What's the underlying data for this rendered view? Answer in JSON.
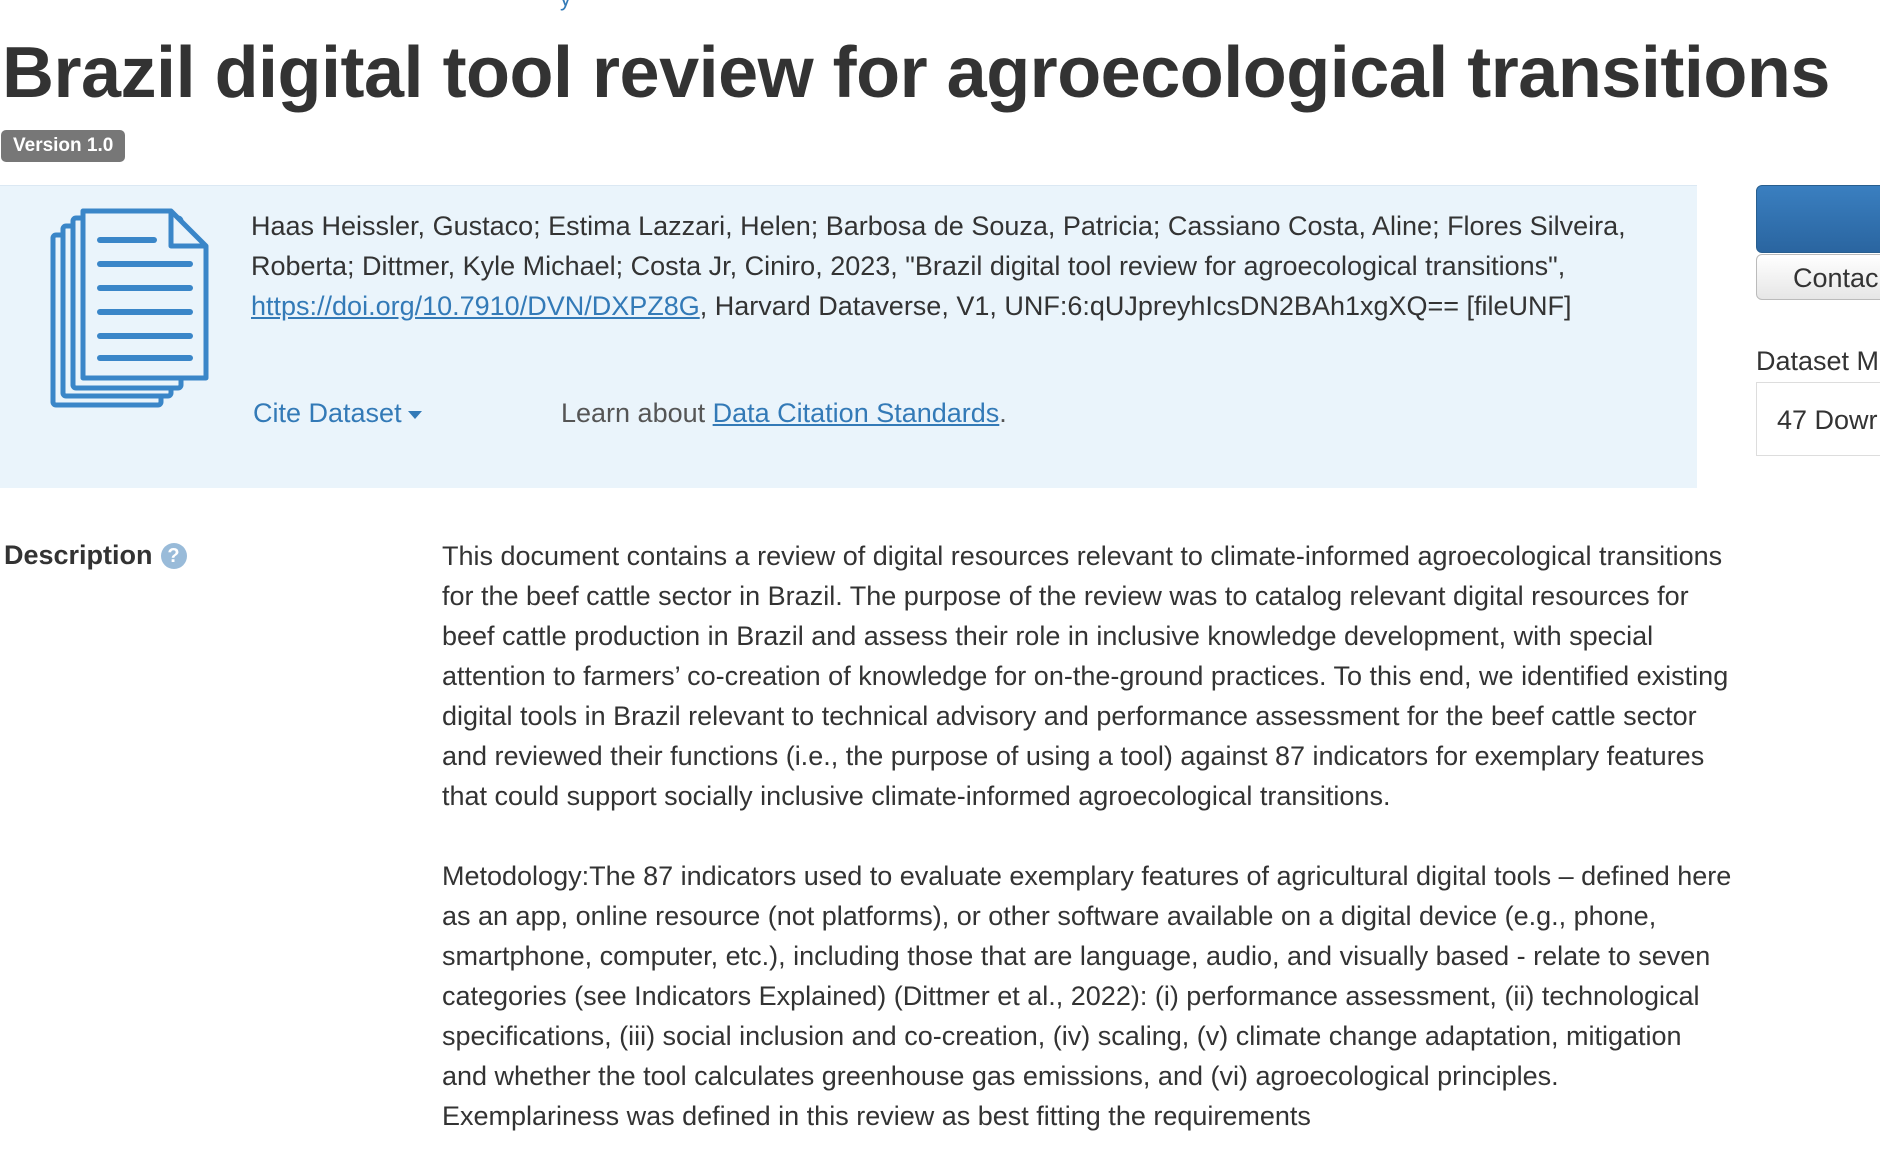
{
  "page": {
    "breadcrumb_fragment": "y"
  },
  "dataset": {
    "title": "Brazil digital tool review for agroecological transitions",
    "version_label": "Version 1.0"
  },
  "citation": {
    "text_before_doi": "Haas Heissler, Gustaco; Estima Lazzari, Helen; Barbosa de Souza, Patricia; Cassiano Costa, Aline; Flores Silveira, Roberta; Dittmer, Kyle Michael; Costa Jr, Ciniro, 2023, \"Brazil digital tool review for agroecological transitions\", ",
    "doi_link": "https://doi.org/10.7910/DVN/DXPZ8G",
    "text_after_doi": ", Harvard Dataverse, V1, UNF:6:qUJpreyhIcsDN2BAh1xgXQ== [fileUNF]",
    "cite_dataset_label": "Cite Dataset",
    "learn_about_prefix": "Learn about ",
    "standards_link": "Data Citation Standards",
    "learn_about_suffix": "."
  },
  "sidebar": {
    "contact_label": "Contac",
    "metrics_label": "Dataset M",
    "downloads_text": "47 Dowr"
  },
  "description": {
    "label": "Description",
    "help_icon": "question-circle-icon",
    "paragraph_1": "This document contains a review of digital resources relevant to climate-informed agroecological transitions for the beef cattle sector in Brazil. The purpose of the review was to catalog relevant digital resources for beef cattle production in Brazil and assess their role in inclusive knowledge development, with special attention to farmers’ co-creation of knowledge for on-the-ground practices. To this end, we identified existing digital tools in Brazil relevant to technical advisory and performance assessment for the beef cattle sector and reviewed their functions (i.e., the purpose of using a tool) against 87 indicators for exemplary features that could support socially inclusive climate-informed agroecological transitions.",
    "paragraph_2": "Metodology:The 87 indicators used to evaluate exemplary features of agricultural digital tools – defined here as an app, online resource (not platforms), or other software available on a digital device (e.g., phone, smartphone, computer, etc.), including those that are language, audio, and visually based - relate to seven categories (see Indicators Explained) (Dittmer et al., 2022): (i) performance assessment, (ii) technological specifications, (iii) social inclusion and co-creation, (iv) scaling, (v) climate change adaptation, mitigation and whether the tool calculates greenhouse gas emissions, and (vi) agroecological principles. Exemplariness was defined in this review as best fitting the requirements"
  },
  "colors": {
    "link": "#337ab7",
    "citation_bg": "#eaf4fb",
    "badge_bg": "#777777",
    "primary_button": "#2a65a0"
  }
}
